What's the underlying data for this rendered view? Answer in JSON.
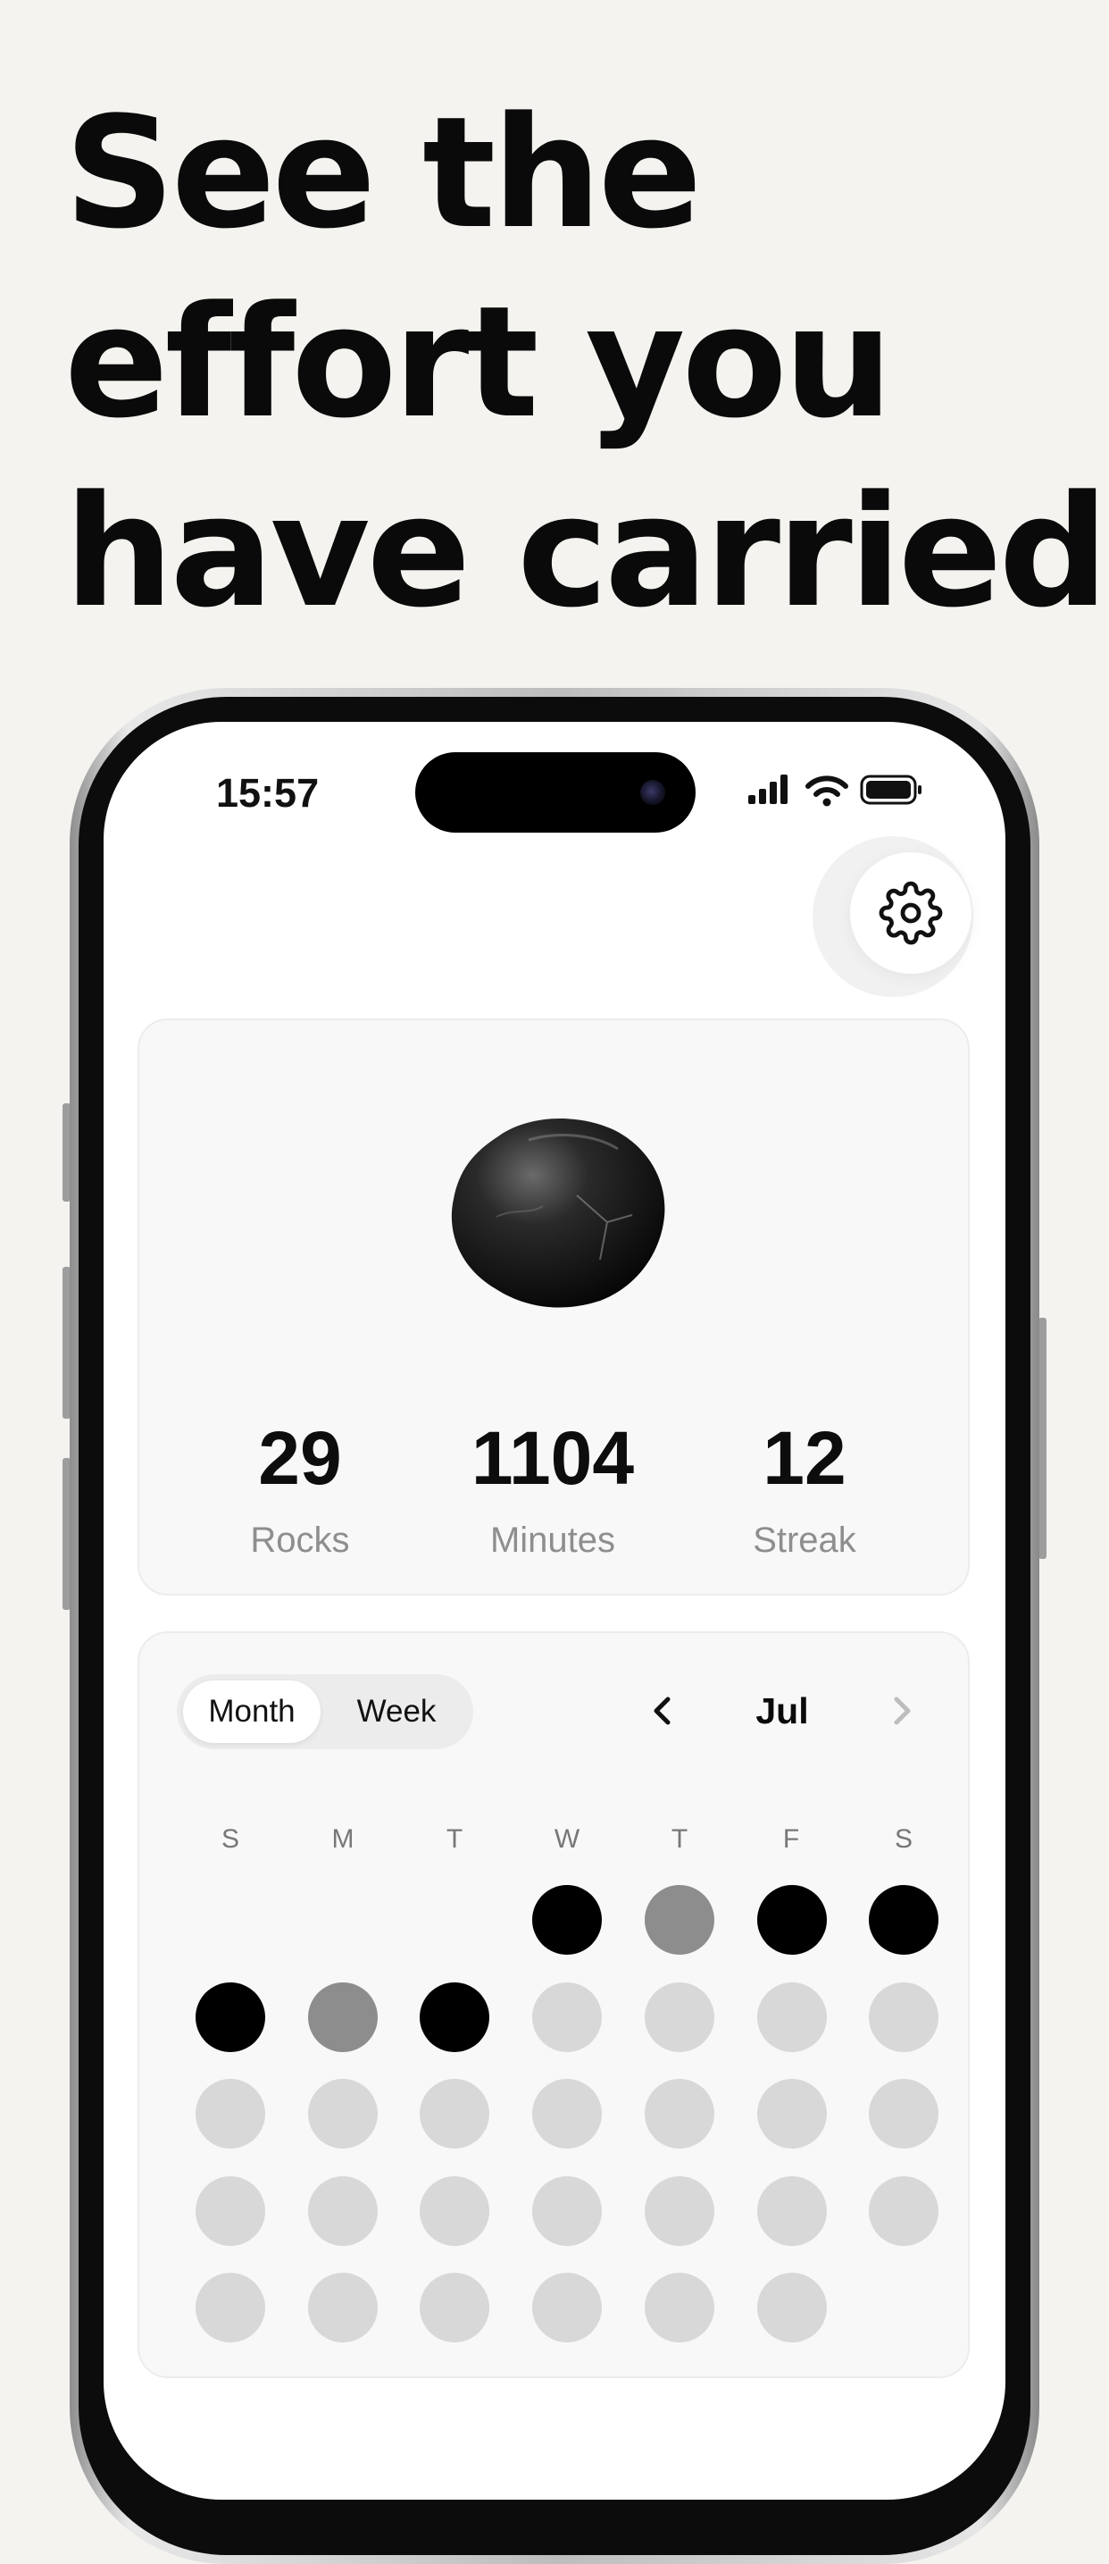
{
  "headline": [
    "See the",
    "effort you",
    "have carried."
  ],
  "status_bar": {
    "time": "15:57"
  },
  "stats": [
    {
      "value": "29",
      "label": "Rocks"
    },
    {
      "value": "1104",
      "label": "Minutes"
    },
    {
      "value": "12",
      "label": "Streak"
    }
  ],
  "calendar": {
    "view_options": {
      "month": "Month",
      "week": "Week"
    },
    "selected_view": "Month",
    "month": "Jul",
    "weekdays": [
      "S",
      "M",
      "T",
      "W",
      "T",
      "F",
      "S"
    ],
    "days_in_month": 31,
    "first_weekday_index": 3,
    "day_states": [
      "full",
      "mid",
      "full",
      "full",
      "full",
      "mid",
      "full",
      "empty",
      "empty",
      "empty",
      "empty",
      "empty",
      "empty",
      "empty",
      "empty",
      "empty",
      "empty",
      "empty",
      "empty",
      "empty",
      "empty",
      "empty",
      "empty",
      "empty",
      "empty",
      "empty",
      "empty",
      "empty",
      "empty",
      "empty",
      "empty"
    ]
  },
  "colors": {
    "full": "#000000",
    "mid": "#8d8d8e",
    "empty": "#d8d8d8",
    "background": "#f4f3ef"
  },
  "icons": {
    "settings": "gear-icon",
    "prev": "chevron-left-icon",
    "next": "chevron-right-icon"
  }
}
